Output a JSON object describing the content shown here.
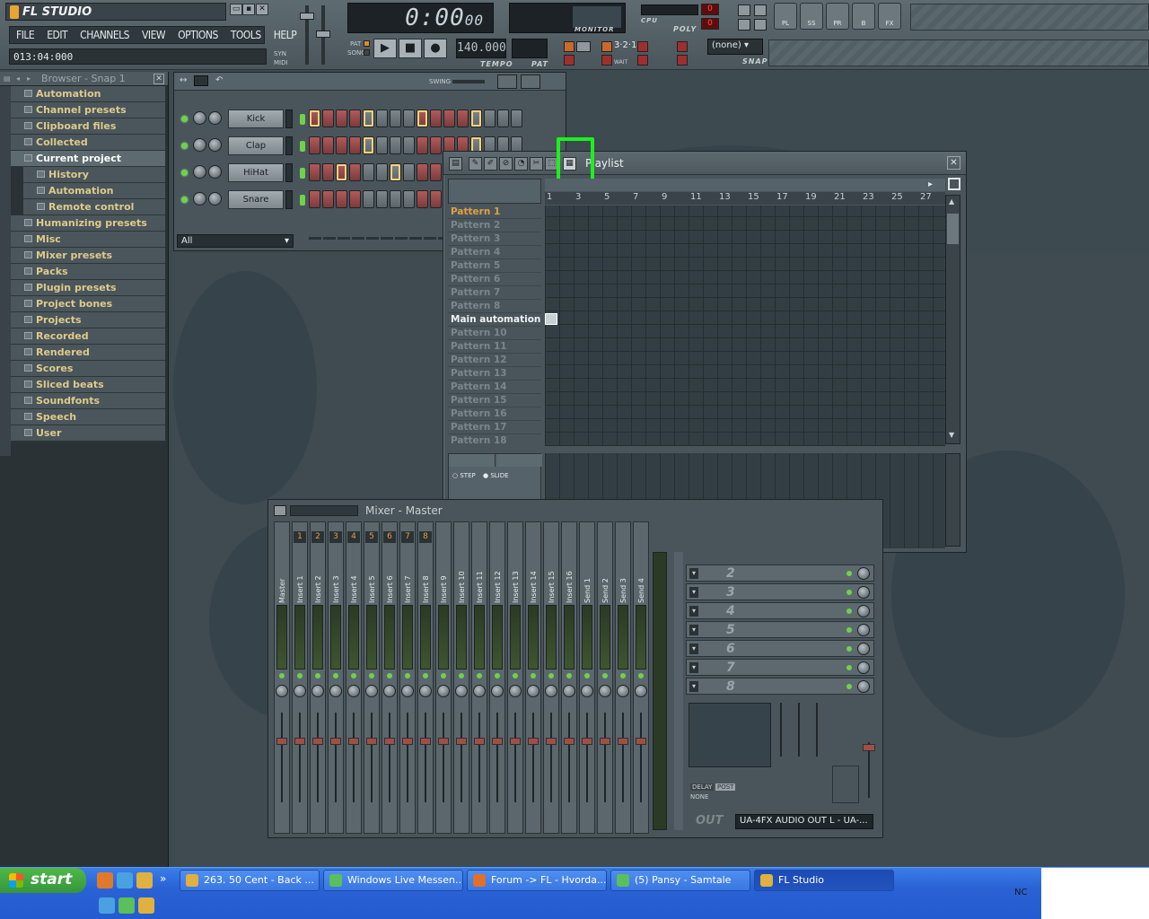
{
  "app": {
    "title": "FL STUDIO",
    "menu": [
      "FILE",
      "EDIT",
      "CHANNELS",
      "VIEW",
      "OPTIONS",
      "TOOLS",
      "HELP"
    ],
    "hint": "013:04:000",
    "time": "0:00",
    "time_small": "00",
    "tempo": "140.000",
    "tempo_label": "TEMPO",
    "pat_label": "PAT",
    "monitor_label": "MONITOR",
    "cpu_label": "CPU",
    "poly_label": "POLY",
    "cpu_value": "0",
    "poly_value": "0",
    "snap_value": "(none)",
    "snap_label": "SNAP",
    "pat_song": [
      "PAT",
      "SONG"
    ],
    "syn_midi": [
      "SYN",
      "MIDI"
    ],
    "wait_label": "WAIT",
    "shortcuts": [
      "PL",
      "SS",
      "PR",
      "B",
      "FX"
    ]
  },
  "browser": {
    "title": "Browser - Snap 1",
    "items": [
      {
        "label": "Automation",
        "sub": false
      },
      {
        "label": "Channel presets",
        "sub": false
      },
      {
        "label": "Clipboard files",
        "sub": false
      },
      {
        "label": "Collected",
        "sub": false
      },
      {
        "label": "Current project",
        "sub": false,
        "current": true
      },
      {
        "label": "History",
        "sub": true
      },
      {
        "label": "Automation",
        "sub": true
      },
      {
        "label": "Remote control",
        "sub": true
      },
      {
        "label": "Humanizing presets",
        "sub": false
      },
      {
        "label": "Misc",
        "sub": false
      },
      {
        "label": "Mixer presets",
        "sub": false
      },
      {
        "label": "Packs",
        "sub": false
      },
      {
        "label": "Plugin presets",
        "sub": false
      },
      {
        "label": "Project bones",
        "sub": false
      },
      {
        "label": "Projects",
        "sub": false
      },
      {
        "label": "Recorded",
        "sub": false
      },
      {
        "label": "Rendered",
        "sub": false
      },
      {
        "label": "Scores",
        "sub": false
      },
      {
        "label": "Sliced beats",
        "sub": false
      },
      {
        "label": "Soundfonts",
        "sub": false
      },
      {
        "label": "Speech",
        "sub": false
      },
      {
        "label": "User",
        "sub": false
      }
    ]
  },
  "stepseq": {
    "swing_label": "SWING",
    "filter": "All",
    "channels": [
      "Kick",
      "Clap",
      "HiHat",
      "Snare"
    ]
  },
  "playlist": {
    "title": "Playlist",
    "ruler": [
      "1",
      "3",
      "5",
      "7",
      "9",
      "11",
      "13",
      "15",
      "17",
      "19",
      "21",
      "23",
      "25",
      "27"
    ],
    "tracks": [
      "Pattern 1",
      "Pattern 2",
      "Pattern 3",
      "Pattern 4",
      "Pattern 5",
      "Pattern 6",
      "Pattern 7",
      "Pattern 8",
      "Main automation",
      "Pattern 10",
      "Pattern 11",
      "Pattern 12",
      "Pattern 13",
      "Pattern 14",
      "Pattern 15",
      "Pattern 16",
      "Pattern 17",
      "Pattern 18"
    ],
    "step_label": "STEP",
    "slide_label": "SLIDE"
  },
  "mixer": {
    "title": "Mixer - Master",
    "strips": [
      "Master",
      "Insert 1",
      "Insert 2",
      "Insert 3",
      "Insert 4",
      "Insert 5",
      "Insert 6",
      "Insert 7",
      "Insert 8",
      "Insert 9",
      "Insert 10",
      "Insert 11",
      "Insert 12",
      "Insert 13",
      "Insert 14",
      "Insert 15",
      "Insert 16",
      "Send 1",
      "Send 2",
      "Send 3",
      "Send 4"
    ],
    "numbers": [
      "1",
      "2",
      "3",
      "4",
      "5",
      "6",
      "7",
      "8"
    ],
    "fx_slots": [
      "2",
      "3",
      "4",
      "5",
      "6",
      "7",
      "8"
    ],
    "out_label": "OUT",
    "output": "UA-4FX AUDIO OUT L - UA-...",
    "delay_label": "DELAY",
    "post_label": "POST",
    "none_label": "NONE"
  },
  "taskbar": {
    "start": "start",
    "items": [
      {
        "label": "263. 50 Cent - Back ...",
        "color": "#e0b040"
      },
      {
        "label": "Windows Live Messen...",
        "color": "#5bbf5b"
      },
      {
        "label": "Forum -> FL - Hvorda...",
        "color": "#e0702a"
      },
      {
        "label": "(5) Pansy - Samtale",
        "color": "#5bbf5b"
      },
      {
        "label": "FL Studio",
        "color": "#e0b040",
        "active": true
      }
    ],
    "lang": "NC"
  }
}
